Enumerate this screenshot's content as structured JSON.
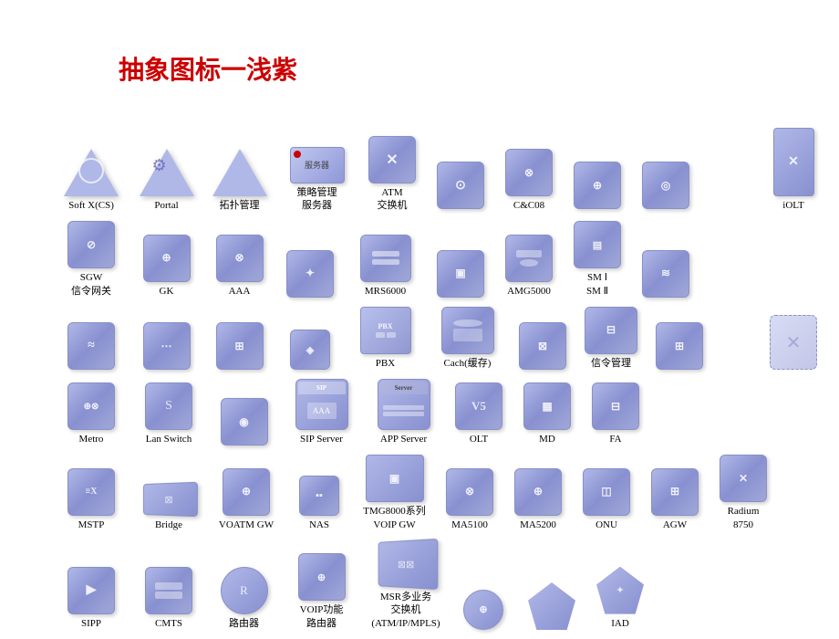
{
  "title": "抽象图标一浅紫",
  "rows": [
    {
      "id": "row1",
      "items": [
        {
          "id": "soft-x",
          "label": "Soft X(CS)",
          "shape": "triangle"
        },
        {
          "id": "portal",
          "label": "Portal",
          "shape": "triangle-gear"
        },
        {
          "id": "topology",
          "label": "拓扑管理",
          "shape": "triangle-plain"
        },
        {
          "id": "policy-server",
          "label": "策略管理\n服务器",
          "shape": "box-red"
        },
        {
          "id": "atm-switch",
          "label": "ATM\n交换机",
          "shape": "box"
        },
        {
          "id": "empty1",
          "label": "",
          "shape": "box"
        },
        {
          "id": "cc08",
          "label": "C&C08",
          "shape": "box"
        },
        {
          "id": "empty2",
          "label": "",
          "shape": "box"
        },
        {
          "id": "empty3",
          "label": "",
          "shape": "box"
        }
      ]
    },
    {
      "id": "row2",
      "items": [
        {
          "id": "sgw",
          "label": "SGW\n信令网关",
          "shape": "box"
        },
        {
          "id": "gk",
          "label": "GK",
          "shape": "box"
        },
        {
          "id": "aaa",
          "label": "AAA",
          "shape": "box"
        },
        {
          "id": "empty4",
          "label": "",
          "shape": "box"
        },
        {
          "id": "mrs6000",
          "label": "MRS6000",
          "shape": "box"
        },
        {
          "id": "empty5",
          "label": "",
          "shape": "box"
        },
        {
          "id": "amg5000",
          "label": "AMG5000",
          "shape": "box"
        },
        {
          "id": "sm",
          "label": "SM Ⅰ\nSM Ⅱ",
          "shape": "box"
        },
        {
          "id": "empty6",
          "label": "",
          "shape": "box"
        },
        {
          "id": "iolt",
          "label": "iOLT",
          "shape": "tall"
        }
      ]
    },
    {
      "id": "row3",
      "items": [
        {
          "id": "r1",
          "label": "",
          "shape": "box"
        },
        {
          "id": "r2",
          "label": "",
          "shape": "box"
        },
        {
          "id": "r3",
          "label": "",
          "shape": "box"
        },
        {
          "id": "r4",
          "label": "",
          "shape": "box"
        },
        {
          "id": "pbx",
          "label": "PBX",
          "shape": "flat"
        },
        {
          "id": "cache",
          "label": "Cach(缓存)",
          "shape": "box"
        },
        {
          "id": "r5",
          "label": "",
          "shape": "box"
        },
        {
          "id": "signal-mgmt",
          "label": "信令管理",
          "shape": "box"
        },
        {
          "id": "r6",
          "label": "",
          "shape": "box"
        },
        {
          "id": "ghost1",
          "label": "",
          "shape": "ghost"
        }
      ]
    },
    {
      "id": "row4",
      "items": [
        {
          "id": "metro",
          "label": "Metro",
          "shape": "box"
        },
        {
          "id": "lan-switch",
          "label": "Lan Switch",
          "shape": "box"
        },
        {
          "id": "empty7",
          "label": "",
          "shape": "box"
        },
        {
          "id": "sip-server",
          "label": "SIP Server",
          "shape": "flat-sip"
        },
        {
          "id": "app-server",
          "label": "APP Server",
          "shape": "flat-server"
        },
        {
          "id": "olt",
          "label": "OLT",
          "shape": "box"
        },
        {
          "id": "md",
          "label": "MD",
          "shape": "box"
        },
        {
          "id": "fa",
          "label": "FA",
          "shape": "box"
        }
      ]
    },
    {
      "id": "row5",
      "items": [
        {
          "id": "mstp",
          "label": "MSTP",
          "shape": "box"
        },
        {
          "id": "bridge",
          "label": "Bridge",
          "shape": "flat-bridge"
        },
        {
          "id": "voatm-gw",
          "label": "VOATM GW",
          "shape": "box"
        },
        {
          "id": "nas",
          "label": "NAS",
          "shape": "box"
        },
        {
          "id": "tmg8000",
          "label": "TMG8000系列\nVOIP GW",
          "shape": "flat"
        },
        {
          "id": "ma5100",
          "label": "MA5100",
          "shape": "box"
        },
        {
          "id": "ma5200",
          "label": "MA5200",
          "shape": "box"
        },
        {
          "id": "onu",
          "label": "ONU",
          "shape": "box"
        },
        {
          "id": "agw",
          "label": "AGW",
          "shape": "box"
        },
        {
          "id": "radium",
          "label": "Radium\n8750",
          "shape": "box"
        }
      ]
    },
    {
      "id": "row6",
      "items": [
        {
          "id": "sipp",
          "label": "SIPP",
          "shape": "box"
        },
        {
          "id": "cmts",
          "label": "CMTS",
          "shape": "box"
        },
        {
          "id": "router",
          "label": "路由器",
          "shape": "circle"
        },
        {
          "id": "voip-router",
          "label": "VOIP功能\n路由器",
          "shape": "box"
        },
        {
          "id": "msr",
          "label": "MSR多业务\n交换机\n(ATM/IP/MPLS)",
          "shape": "flat-msr"
        },
        {
          "id": "empty8",
          "label": "",
          "shape": "circle-sm"
        },
        {
          "id": "empty9",
          "label": "",
          "shape": "pentagon"
        },
        {
          "id": "iad",
          "label": "IAD",
          "shape": "pentagon"
        }
      ]
    }
  ]
}
